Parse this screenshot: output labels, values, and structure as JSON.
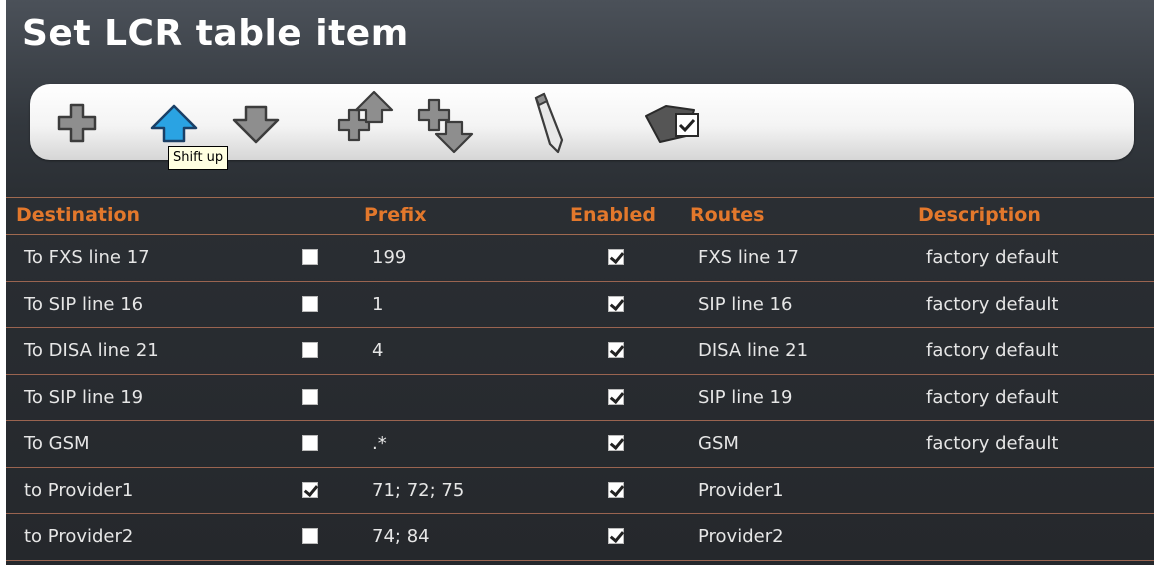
{
  "page": {
    "title": "Set LCR table item"
  },
  "toolbar": {
    "buttons": [
      {
        "name": "add-icon"
      },
      {
        "name": "shift-up-icon"
      },
      {
        "name": "shift-down-icon"
      },
      {
        "name": "move-top-icon"
      },
      {
        "name": "move-bottom-icon"
      },
      {
        "name": "edit-pencil-icon"
      },
      {
        "name": "apply-icon"
      }
    ],
    "tooltip": "Shift up"
  },
  "colors": {
    "accent": "#e3782c",
    "active_icon": "#2aa3e3"
  },
  "table": {
    "headers": {
      "destination": "Destination",
      "prefix": "Prefix",
      "enabled": "Enabled",
      "routes": "Routes",
      "description": "Description"
    },
    "rows": [
      {
        "destination": "To FXS line 17",
        "selected": false,
        "prefix": "199",
        "enabled": true,
        "routes": "FXS line 17",
        "description": "factory default"
      },
      {
        "destination": "To SIP line 16",
        "selected": false,
        "prefix": "1",
        "enabled": true,
        "routes": "SIP line 16",
        "description": "factory default"
      },
      {
        "destination": "To DISA line 21",
        "selected": false,
        "prefix": "4",
        "enabled": true,
        "routes": "DISA line 21",
        "description": "factory default"
      },
      {
        "destination": "To SIP line 19",
        "selected": false,
        "prefix": "",
        "enabled": true,
        "routes": "SIP line 19",
        "description": "factory default"
      },
      {
        "destination": "To GSM",
        "selected": false,
        "prefix": ".*",
        "enabled": true,
        "routes": "GSM",
        "description": "factory default"
      },
      {
        "destination": "to Provider1",
        "selected": true,
        "prefix": "71; 72; 75",
        "enabled": true,
        "routes": "Provider1",
        "description": ""
      },
      {
        "destination": "to Provider2",
        "selected": false,
        "prefix": "74; 84",
        "enabled": true,
        "routes": "Provider2",
        "description": ""
      }
    ]
  }
}
